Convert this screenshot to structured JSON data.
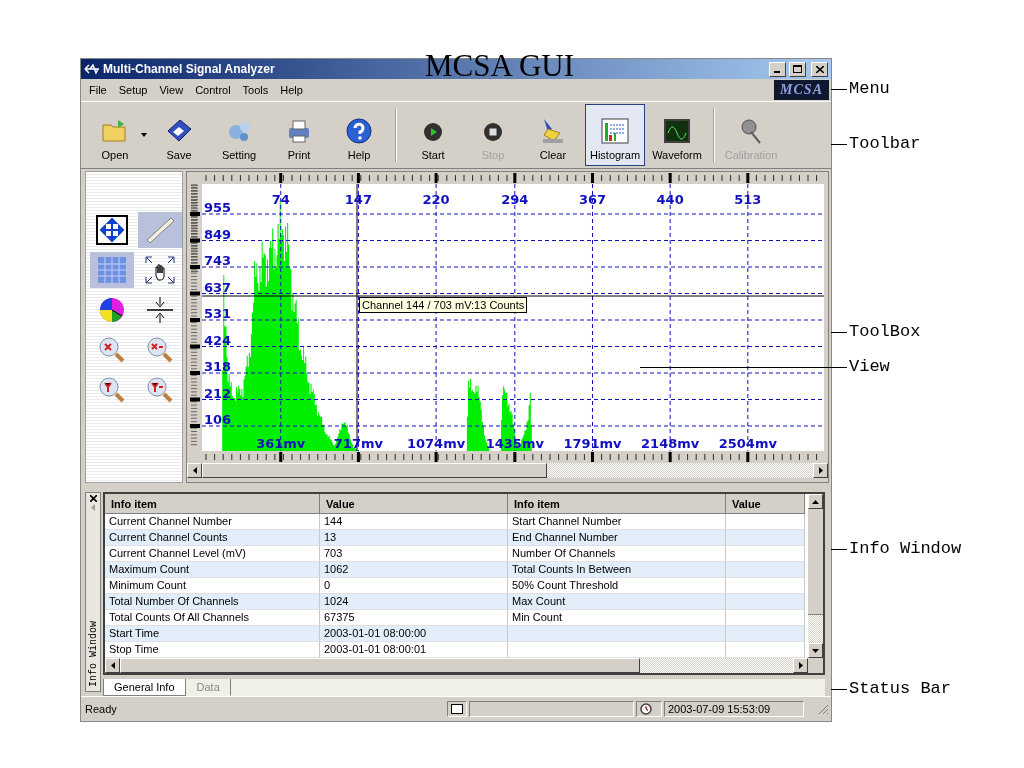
{
  "figure_title": "MCSA GUI",
  "window": {
    "title": "Multi-Channel Signal Analyzer"
  },
  "menu": {
    "items": [
      "File",
      "Setup",
      "View",
      "Control",
      "Tools",
      "Help"
    ],
    "logo": "MCSA"
  },
  "toolbar": {
    "buttons": [
      {
        "kind": "open",
        "label": "Open",
        "selected": false,
        "disabled": false
      },
      {
        "kind": "save",
        "label": "Save",
        "selected": false,
        "disabled": false
      },
      {
        "kind": "setting",
        "label": "Setting",
        "selected": false,
        "disabled": false
      },
      {
        "kind": "print",
        "label": "Print",
        "selected": false,
        "disabled": false
      },
      {
        "kind": "help",
        "label": "Help",
        "selected": false,
        "disabled": false
      },
      {
        "kind": "start",
        "label": "Start",
        "selected": false,
        "disabled": false
      },
      {
        "kind": "stop",
        "label": "Stop",
        "selected": false,
        "disabled": true
      },
      {
        "kind": "clear",
        "label": "Clear",
        "selected": false,
        "disabled": false
      },
      {
        "kind": "histogram",
        "label": "Histogram",
        "selected": true,
        "disabled": false
      },
      {
        "kind": "waveform",
        "label": "Waveform",
        "selected": false,
        "disabled": false
      },
      {
        "kind": "calibration",
        "label": "Calibration",
        "selected": false,
        "disabled": true
      }
    ]
  },
  "toolbox": {
    "tools": [
      {
        "kind": "move",
        "selected": false
      },
      {
        "kind": "ruler",
        "selected": true
      },
      {
        "kind": "grid",
        "selected": true
      },
      {
        "kind": "hand-zoom",
        "selected": false
      },
      {
        "kind": "pie",
        "selected": false
      },
      {
        "kind": "compress",
        "selected": false
      },
      {
        "kind": "zoom-x-in",
        "selected": false
      },
      {
        "kind": "zoom-x-out",
        "selected": false
      },
      {
        "kind": "zoom-y-in",
        "selected": false
      },
      {
        "kind": "zoom-y-out",
        "selected": false
      }
    ]
  },
  "view": {
    "x_ticks": [
      "74",
      "147",
      "220",
      "294",
      "367",
      "440",
      "513"
    ],
    "y_ticks": [
      "955",
      "849",
      "743",
      "637",
      "531",
      "424",
      "318",
      "212",
      "106"
    ],
    "mv_labels": [
      "361mv",
      "717mv",
      "1074mv",
      "1435mv",
      "1791mv",
      "2148mv",
      "2504mv"
    ],
    "tooltip": "Channel 144 / 703 mV:13 Counts"
  },
  "info_window": {
    "title": "Info Window",
    "columns": [
      "Info item",
      "Value",
      "Info item",
      "Value"
    ],
    "rows": [
      {
        "cells": [
          "Current Channel Number",
          "144",
          "Start Channel Number"
        ]
      },
      {
        "cells": [
          "Current Channel Counts",
          "13",
          "End Channel Number"
        ]
      },
      {
        "cells": [
          "Current Channel Level (mV)",
          "703",
          "Number Of Channels"
        ]
      },
      {
        "cells": [
          "Maximum Count",
          "1062",
          "Total Counts In Between"
        ]
      },
      {
        "cells": [
          "Minimum Count",
          "0",
          "50% Count Threshold"
        ]
      },
      {
        "cells": [
          "Total Number Of Channels",
          "1024",
          "Max Count"
        ]
      },
      {
        "cells": [
          "Total Counts Of All Channels",
          "67375",
          "Min Count"
        ]
      },
      {
        "cells": [
          "Start Time",
          "2003-01-01 08:00:00"
        ]
      },
      {
        "cells": [
          "Stop Time",
          "2003-01-01 08:00:01"
        ]
      }
    ],
    "tabs": [
      {
        "label": "General Info",
        "selected": true
      },
      {
        "label": "Data",
        "selected": false
      }
    ]
  },
  "status_bar": {
    "text": "Ready",
    "datetime": "2003-07-09 15:53:09"
  },
  "callouts": [
    "Menu",
    "Toolbar",
    "ToolBox",
    "View",
    "Info Window",
    "Status Bar"
  ]
}
